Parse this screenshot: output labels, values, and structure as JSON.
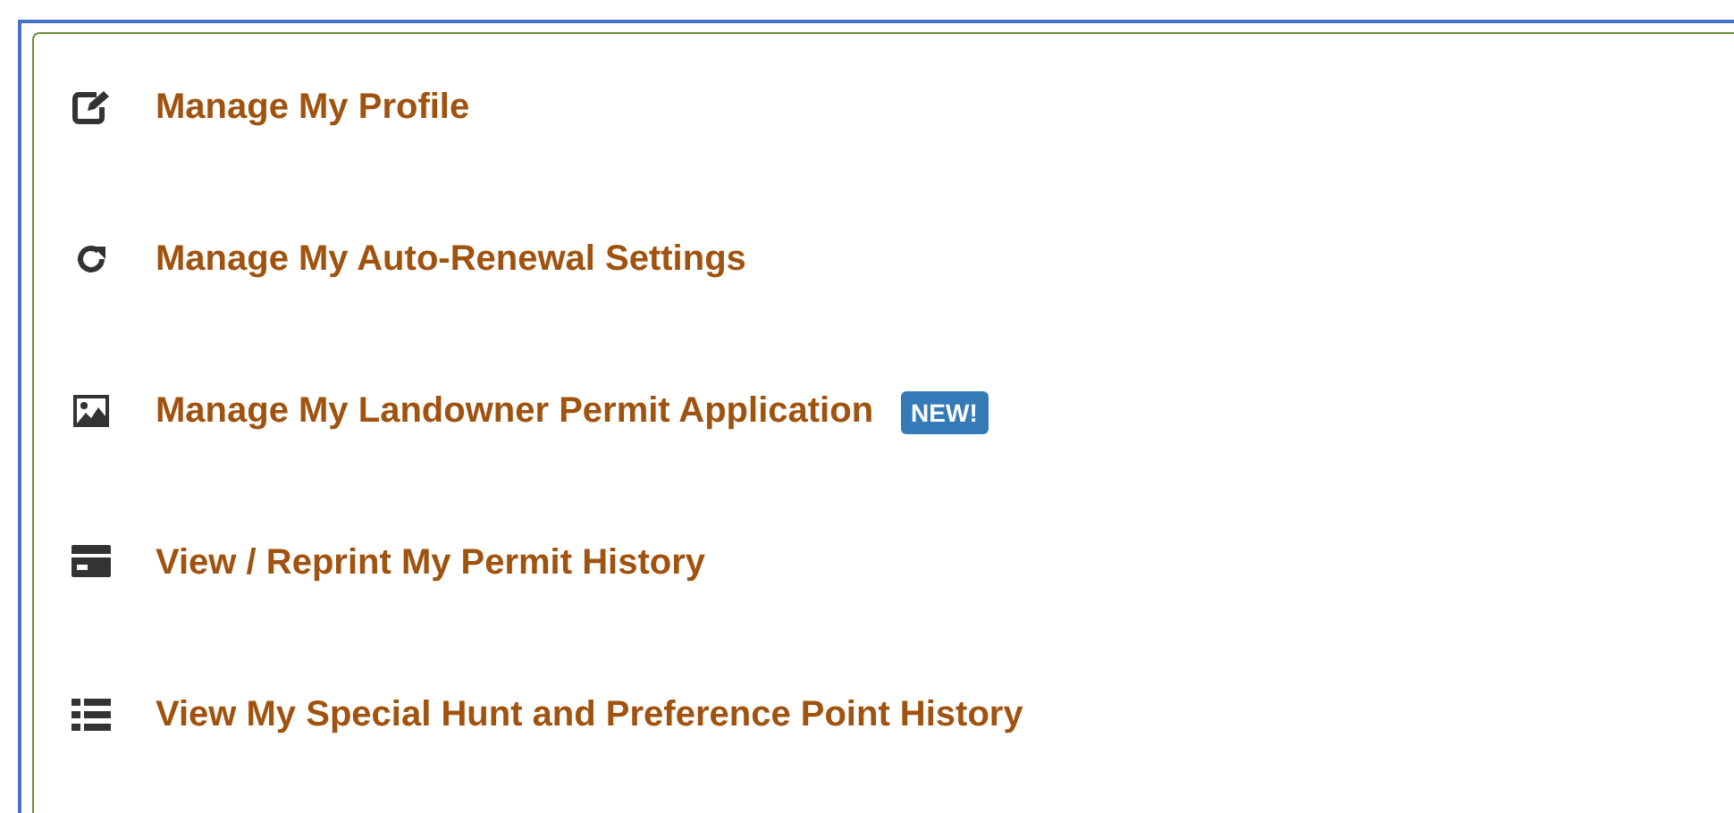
{
  "menu": {
    "items": [
      {
        "kind": "edit",
        "label": "Manage My Profile"
      },
      {
        "kind": "refresh",
        "label": "Manage My Auto-Renewal Settings"
      },
      {
        "kind": "image",
        "label": "Manage My Landowner Permit Application",
        "badge": "NEW!"
      },
      {
        "kind": "card",
        "label": "View / Reprint My Permit History"
      },
      {
        "kind": "list",
        "label": "View My Special Hunt and Preference Point History"
      }
    ]
  }
}
